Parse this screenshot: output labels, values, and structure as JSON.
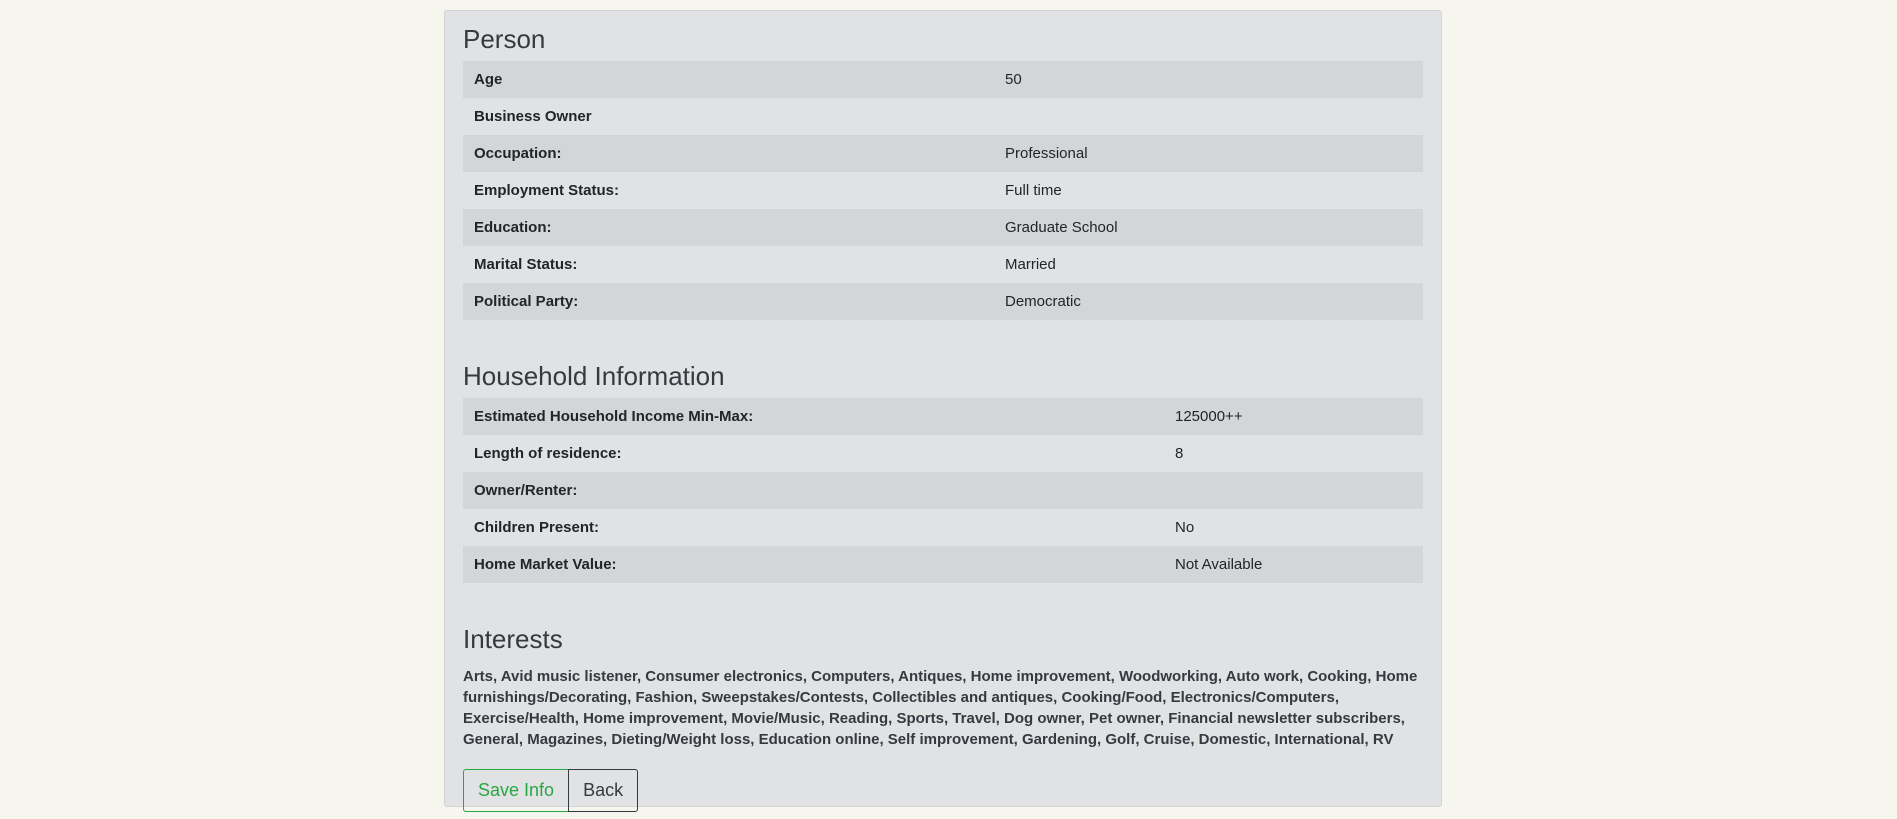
{
  "person": {
    "title": "Person",
    "rows": [
      {
        "label": "Age",
        "value": "50"
      },
      {
        "label": "Business Owner",
        "value": ""
      },
      {
        "label": "Occupation:",
        "value": "Professional"
      },
      {
        "label": "Employment Status:",
        "value": "Full time"
      },
      {
        "label": "Education:",
        "value": "Graduate School"
      },
      {
        "label": "Marital Status:",
        "value": "Married"
      },
      {
        "label": "Political Party:",
        "value": "Democratic"
      }
    ]
  },
  "household": {
    "title": "Household Information",
    "rows": [
      {
        "label": "Estimated Household Income Min-Max:",
        "value": "125000++"
      },
      {
        "label": "Length of residence:",
        "value": "8"
      },
      {
        "label": "Owner/Renter:",
        "value": ""
      },
      {
        "label": "Children Present:",
        "value": "No"
      },
      {
        "label": "Home Market Value:",
        "value": "Not Available"
      }
    ]
  },
  "interests": {
    "title": "Interests",
    "text": "Arts, Avid music listener, Consumer electronics, Computers, Antiques, Home improvement, Woodworking, Auto work, Cooking, Home furnishings/Decorating, Fashion, Sweepstakes/Contests, Collectibles and antiques, Cooking/Food, Electronics/Computers, Exercise/Health, Home improvement, Movie/Music, Reading, Sports, Travel, Dog owner, Pet owner, Financial newsletter subscribers, General, Magazines, Dieting/Weight loss, Education online, Self improvement, Gardening, Golf, Cruise, Domestic, International, RV"
  },
  "actions": {
    "save_label": "Save Info",
    "back_label": "Back"
  },
  "colors": {
    "page_background": "#f6f6ee",
    "card_background": "#e1e2e4",
    "stripe": "#d4d5d7",
    "save_accent": "#28a745",
    "back_accent": "#343a40"
  }
}
